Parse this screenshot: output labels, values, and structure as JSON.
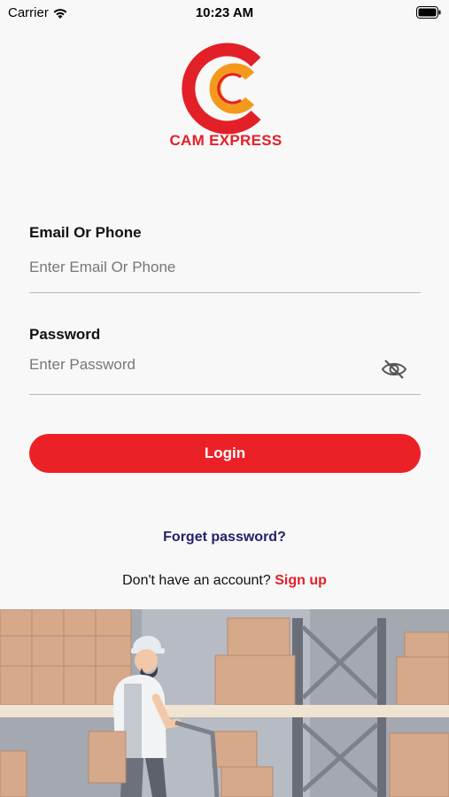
{
  "status_bar": {
    "carrier": "Carrier",
    "time": "10:23 AM"
  },
  "brand": {
    "name": "CAM EXPRESS",
    "primary_color": "#e32028",
    "secondary_color": "#f39a1c"
  },
  "form": {
    "email_label": "Email Or Phone",
    "email_placeholder": "Enter Email Or Phone",
    "password_label": "Password",
    "password_placeholder": "Enter Password",
    "password_toggle_icon": "eye-off-icon"
  },
  "actions": {
    "login_label": "Login",
    "forget_password": "Forget password?",
    "no_account_text": "Don't have an account?",
    "signup_label": "Sign up"
  }
}
